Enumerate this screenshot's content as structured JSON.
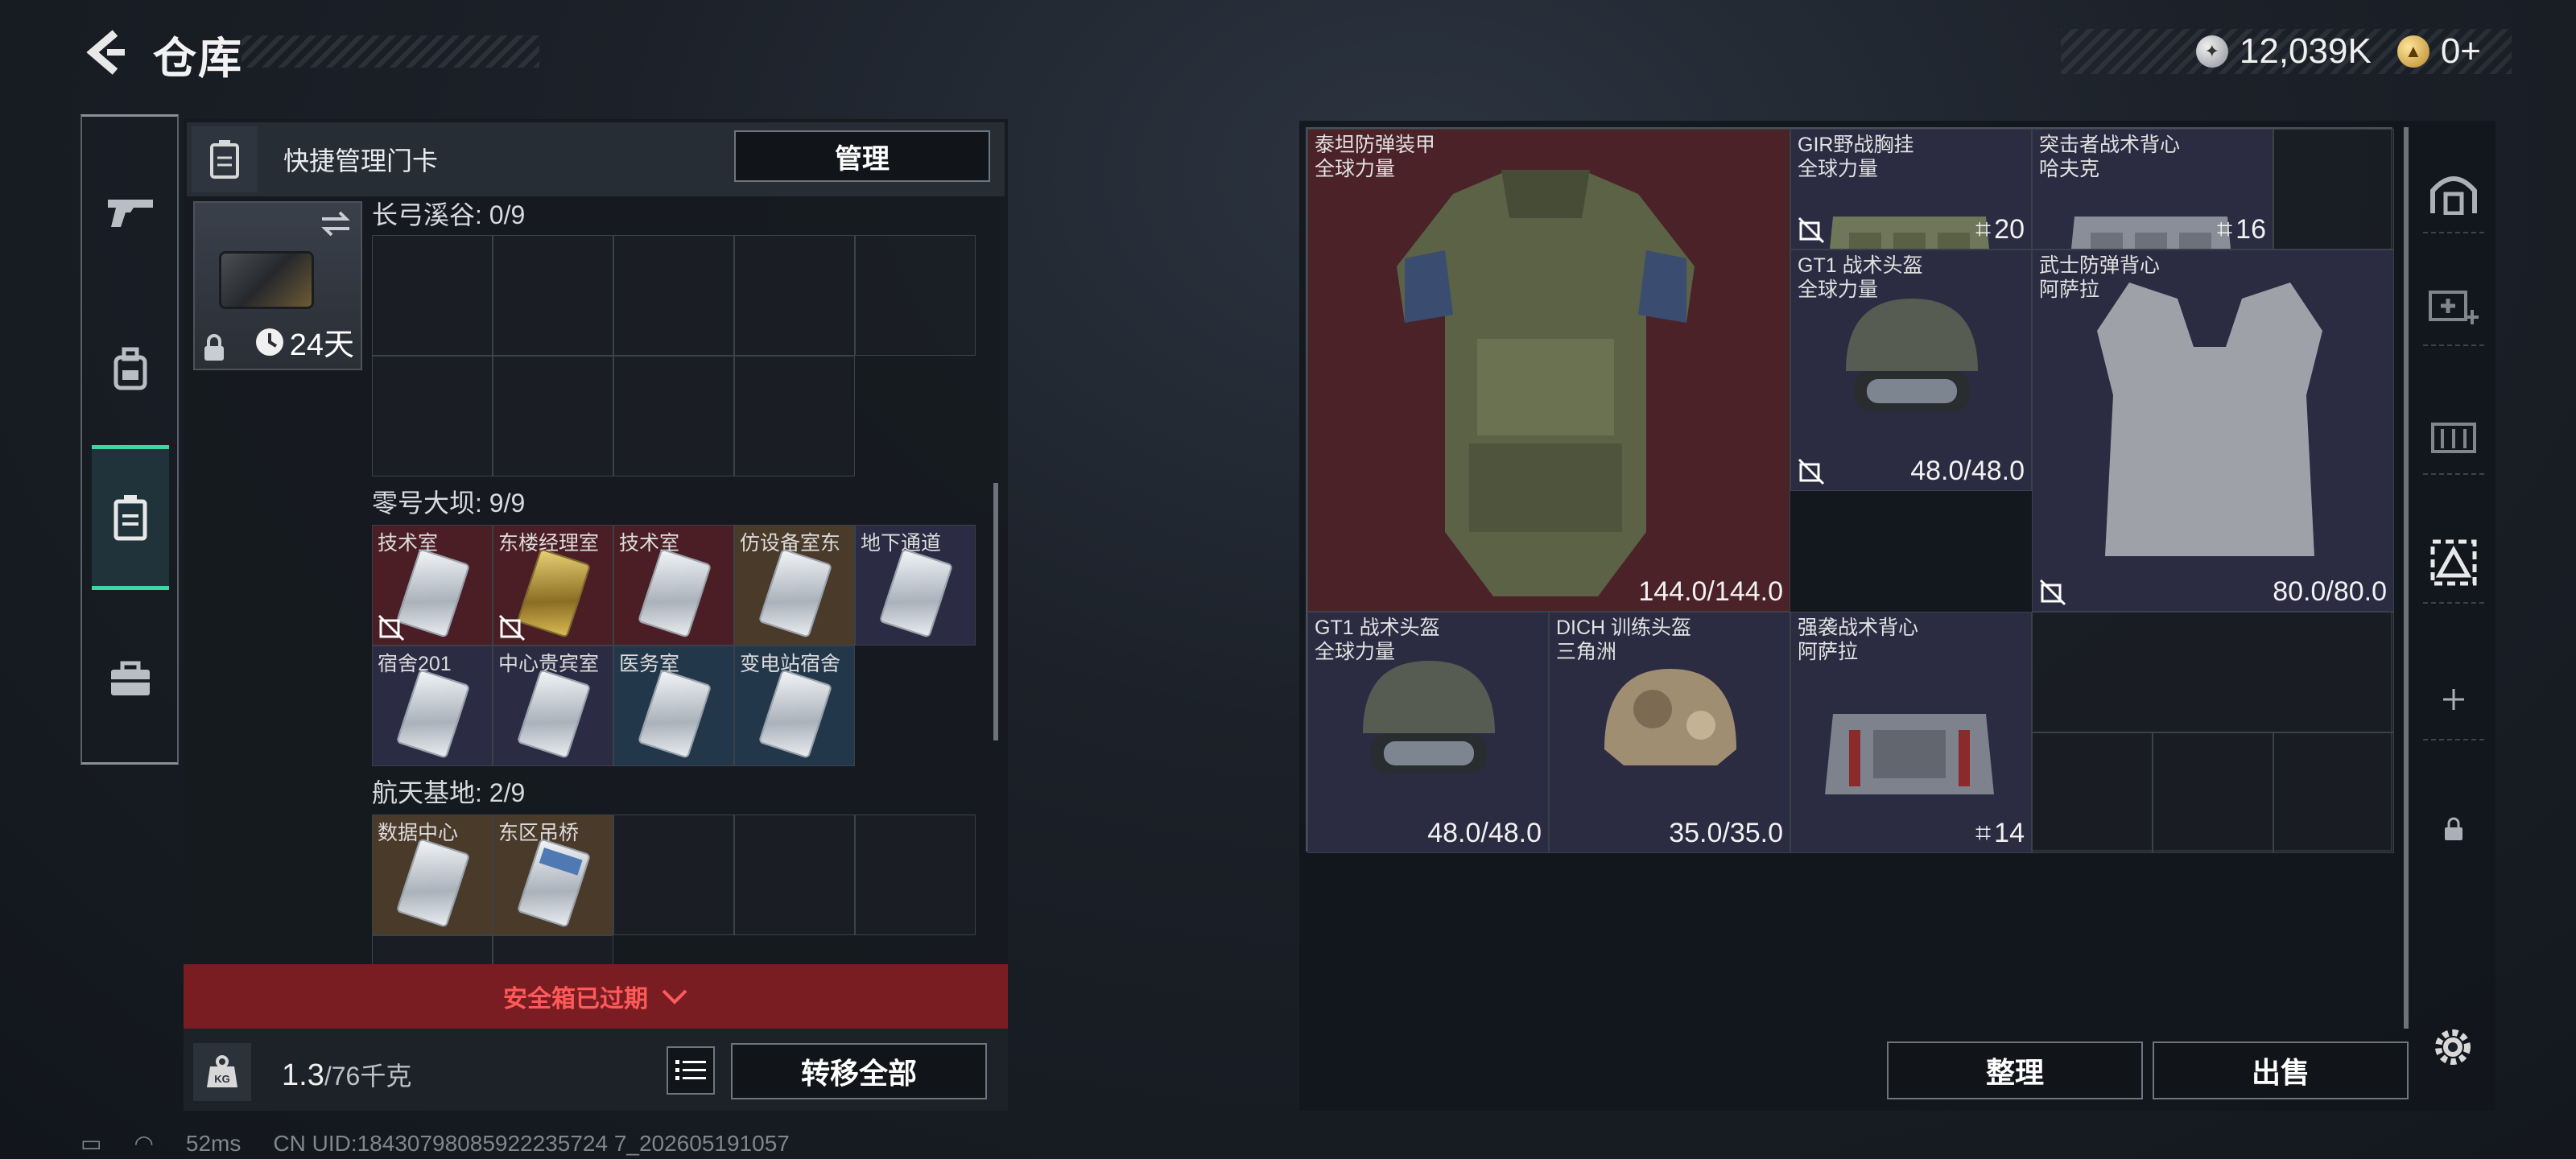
{
  "header": {
    "title": "仓库",
    "back_icon": "back-arrow-icon",
    "currency_silver": "12,039K",
    "currency_gold": "0+"
  },
  "left_nav": [
    {
      "icon": "pistol-icon",
      "active": false
    },
    {
      "icon": "backpack-icon",
      "active": false
    },
    {
      "icon": "keycard-case-icon",
      "active": true
    },
    {
      "icon": "briefcase-icon",
      "active": false
    }
  ],
  "quick_manage": {
    "label": "快捷管理门卡",
    "button": "管理",
    "slot_days": "24天"
  },
  "sections": [
    {
      "title": "长弓溪谷: 0/9",
      "cells": []
    },
    {
      "title": "零号大坝: 9/9",
      "cells": [
        {
          "label": "技术室",
          "color": "red"
        },
        {
          "label": "东楼经理室",
          "color": "red"
        },
        {
          "label": "技术室",
          "color": "red"
        },
        {
          "label": "仿设备室东",
          "color": "brown"
        },
        {
          "label": "地下通道",
          "color": "purple"
        },
        {
          "label": "宿舍201",
          "color": "purple"
        },
        {
          "label": "中心贵宾室",
          "color": "purple"
        },
        {
          "label": "医务室",
          "color": "blue"
        },
        {
          "label": "变电站宿舍",
          "color": "blue"
        }
      ]
    },
    {
      "title": "航天基地: 2/9",
      "cells": [
        {
          "label": "数据中心",
          "color": "brown"
        },
        {
          "label": "东区吊桥",
          "color": "brown"
        }
      ]
    }
  ],
  "safe_box": {
    "expired": "安全箱已过期"
  },
  "bottom": {
    "weight_current": "1.3",
    "weight_max": "/76千克",
    "transfer_all": "转移全部",
    "kg_icon": "KG"
  },
  "status": {
    "ping": "52ms",
    "uid": "CN UID:18430798085922235724 7_202605191057"
  },
  "stash_items": [
    {
      "name": "泰坦防弹装甲",
      "sub": "全球力量",
      "value": "144.0/144.0"
    },
    {
      "name": "GIR野战胸挂",
      "sub": "全球力量",
      "volume": "20"
    },
    {
      "name": "突击者战术背心",
      "sub": "哈夫克",
      "volume": "16"
    },
    {
      "name": "GT1 战术头盔",
      "sub": "全球力量",
      "value": "48.0/48.0"
    },
    {
      "name": "武士防弹背心",
      "sub": "阿萨拉",
      "value": "80.0/80.0"
    },
    {
      "name": "GT1 战术头盔",
      "sub": "全球力量",
      "value": "48.0/48.0"
    },
    {
      "name": "DICH 训练头盔",
      "sub": "三角洲",
      "value": "35.0/35.0"
    },
    {
      "name": "强袭战术背心",
      "sub": "阿萨拉",
      "volume": "14"
    }
  ],
  "actions": {
    "sort": "整理",
    "sell": "出售"
  },
  "colors": {
    "accent": "#3fd6a2",
    "danger": "#ff5a5a",
    "rarity_red": "#4b2228",
    "rarity_purple": "#2b2b42"
  }
}
